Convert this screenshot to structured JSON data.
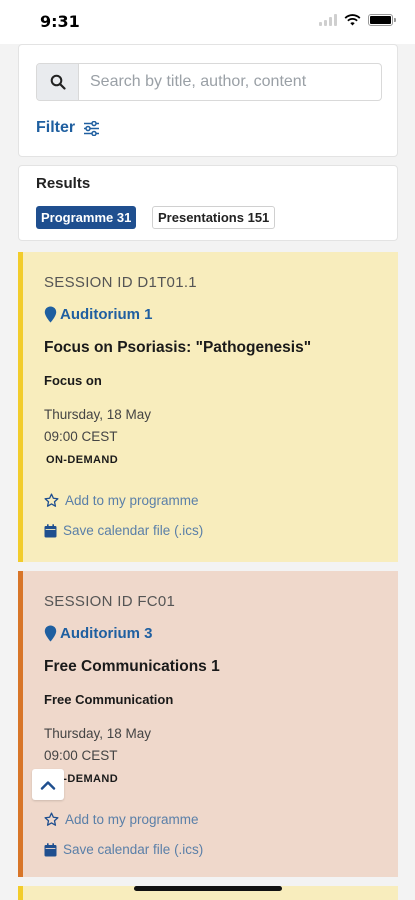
{
  "status_bar": {
    "time": "9:31"
  },
  "search": {
    "placeholder": "Search by title, author, content",
    "filter_label": "Filter"
  },
  "results": {
    "title": "Results",
    "tabs": [
      {
        "label": "Programme 31",
        "active": true
      },
      {
        "label": "Presentations 151",
        "active": false
      }
    ]
  },
  "sessions": [
    {
      "session_id": "SESSION ID D1T01.1",
      "room": "Auditorium 1",
      "title": "Focus on Psoriasis: \"Pathogenesis\"",
      "type": "Focus on",
      "date": "Thursday, 18 May",
      "time": "09:00 CEST",
      "flag": "ON-DEMAND",
      "add_label": "Add to my programme",
      "calendar_label": "Save calendar file (.ics)",
      "accent_color": "#f2cc2b",
      "background_color": "#f8edbd"
    },
    {
      "session_id": "SESSION ID FC01",
      "room": "Auditorium 3",
      "title": "Free Communications 1",
      "type": "Free Communication",
      "date": "Thursday, 18 May",
      "time": "09:00 CEST",
      "flag": "ON-DEMAND",
      "add_label": "Add to my programme",
      "calendar_label": "Save calendar file (.ics)",
      "accent_color": "#d87528",
      "background_color": "#efd8cb"
    }
  ],
  "colors": {
    "brand_blue": "#1f5fa0",
    "tab_active": "#1f4f8f"
  },
  "icons": [
    "search-icon",
    "filter-sliders-icon",
    "location-pin-icon",
    "star-outline-icon",
    "calendar-icon",
    "chevron-up-icon",
    "wifi-icon",
    "battery-icon"
  ]
}
